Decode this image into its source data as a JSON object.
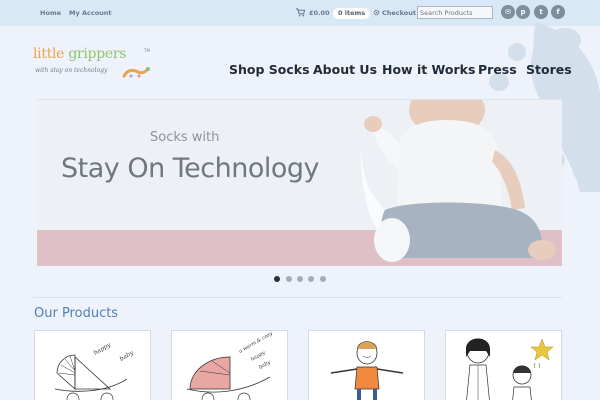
{
  "topbar": {
    "home": "Home",
    "my_account": "My Account",
    "cart_amount": "£0.00",
    "cart_items": "0 items",
    "checkout": "Checkout",
    "search_placeholder": "Search Products",
    "social_icons": [
      "envelope-icon",
      "pinterest-icon",
      "twitter-icon",
      "facebook-icon"
    ]
  },
  "logo": {
    "word1": "little",
    "word2": "grippers",
    "tm": "TM",
    "tagline": "with stay on technology"
  },
  "nav": [
    "Shop Socks",
    "About Us",
    "How it Works",
    "Press",
    "Stores"
  ],
  "hero": {
    "line1": "Socks with",
    "line2": "Stay On Technology",
    "slide_count": 5,
    "active_slide": 1
  },
  "products": {
    "title": "Our Products",
    "images": [
      "pram-sketch-product",
      "pink-pram-product",
      "child-sketch-product",
      "family-sketch-product"
    ]
  },
  "colors": {
    "topbar": "#d9e8f6",
    "background": "#eef3fb",
    "accent": "#4e7fb5",
    "nav_text": "#1f2b38"
  }
}
